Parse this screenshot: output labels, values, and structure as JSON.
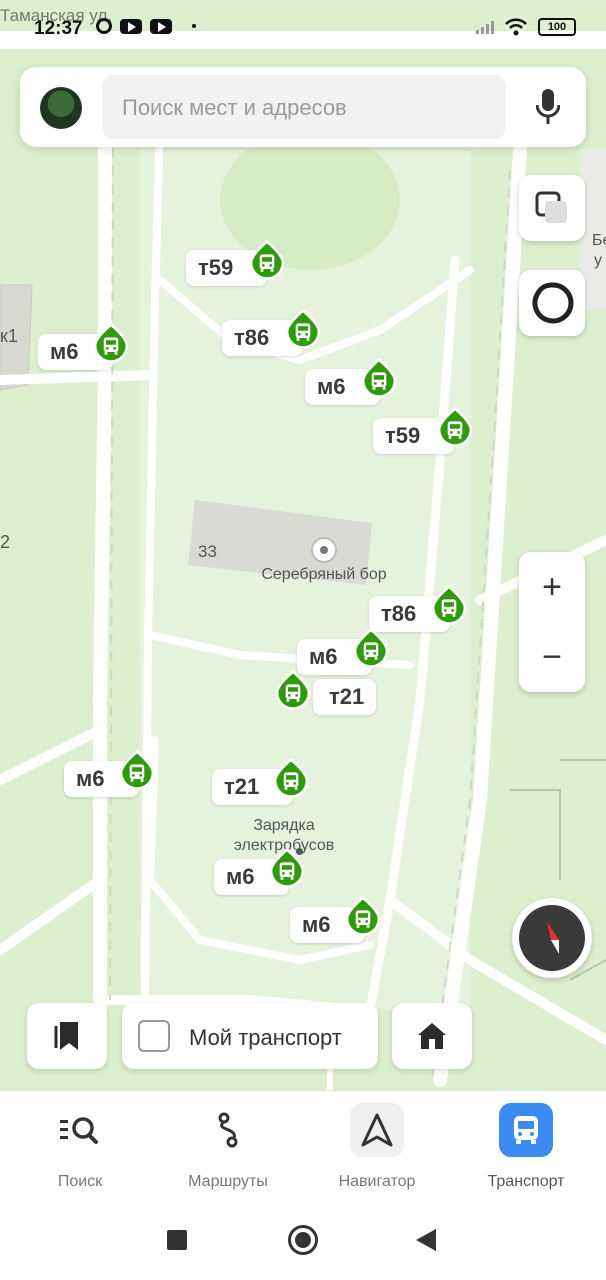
{
  "status_bar": {
    "time": "12:37",
    "battery": "100"
  },
  "map": {
    "street_top": "Таманская ул.",
    "edge_labels": [
      "к1",
      "2",
      "Бе",
      "у"
    ],
    "place_number": "33",
    "place_name": "Серебряный бор",
    "depot_label": "Зарядка\nэлектробусов"
  },
  "search": {
    "placeholder": "Поиск мест и адресов"
  },
  "stops": [
    {
      "route": "т59"
    },
    {
      "route": "м6"
    },
    {
      "route": "т86"
    },
    {
      "route": "м6"
    },
    {
      "route": "т59"
    },
    {
      "route": "т86"
    },
    {
      "route": "м6"
    },
    {
      "route": "т21"
    },
    {
      "route": "м6"
    },
    {
      "route": "т21"
    },
    {
      "route": "м6"
    },
    {
      "route": "м6"
    }
  ],
  "controls": {
    "zoom_in": "+",
    "zoom_out": "−",
    "my_transport_label": "Мой транспорт",
    "my_transport_checked": false
  },
  "tabs": [
    {
      "label": "Поиск",
      "icon": "search-list-icon",
      "active": false
    },
    {
      "label": "Маршруты",
      "icon": "route-icon",
      "active": false
    },
    {
      "label": "Навигатор",
      "icon": "navigator-arrow-icon",
      "active": false
    },
    {
      "label": "Транспорт",
      "icon": "bus-icon",
      "active": true
    }
  ],
  "colors": {
    "stop_green": "#2e9a0c",
    "active_tab": "#3a8cf0",
    "map_bg": "#dcefcf"
  }
}
